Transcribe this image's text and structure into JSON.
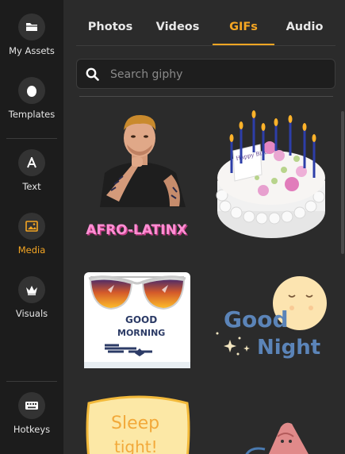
{
  "sidebar": {
    "items": [
      {
        "label": "My Assets",
        "icon": "folder-icon"
      },
      {
        "label": "Templates",
        "icon": "egg-icon"
      },
      {
        "label": "Text",
        "icon": "text-icon"
      },
      {
        "label": "Media",
        "icon": "image-icon"
      },
      {
        "label": "Visuals",
        "icon": "crown-icon"
      },
      {
        "label": "Hotkeys",
        "icon": "keyboard-icon"
      }
    ],
    "active": "Media"
  },
  "tabs": [
    {
      "label": "Photos"
    },
    {
      "label": "Videos"
    },
    {
      "label": "GIFs"
    },
    {
      "label": "Audio"
    }
  ],
  "active_tab": "GIFs",
  "search": {
    "placeholder": "Search giphy",
    "value": ""
  },
  "gifs": {
    "afro_text": "AFRO-LATINX",
    "candle_text": "Happy Birthday",
    "morning_text_1": "GOOD",
    "morning_text_2": "MORNING",
    "good_text": "Good",
    "night_text": "Night",
    "sleep_text_1": "Sleep",
    "sleep_text_2": "tight!"
  },
  "colors": {
    "accent": "#f5a623",
    "sidebar_bg": "#1c1c1c",
    "panel_bg": "#2b2b2b"
  }
}
